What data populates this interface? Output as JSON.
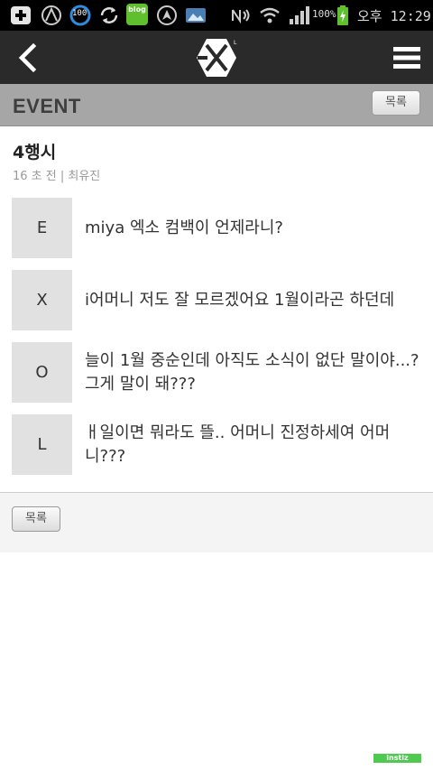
{
  "status_bar": {
    "badge_100": "100",
    "blog_label": "blog",
    "battery_percent": "100%",
    "time_label": "오후 12:29"
  },
  "app_bar": {
    "back_icon": "chevron-left-icon",
    "logo": "exo-logo",
    "menu_icon": "hamburger-menu-icon"
  },
  "section": {
    "title": "EVENT",
    "list_button": "목록"
  },
  "post": {
    "title": "4행시",
    "meta": "16 초 전 | 최유진",
    "rows": [
      {
        "letter": "E",
        "text": "miya 엑소 컴백이 언제라니?"
      },
      {
        "letter": "X",
        "text": "i어머니 저도 잘 모르겠어요 1월이라곤 하던데"
      },
      {
        "letter": "O",
        "text": "늘이 1월 중순인데 아직도 소식이 없단 말이야...? 그게 말이 돼???"
      },
      {
        "letter": "L",
        "text": "ㅐ일이면 뭐라도 뜰.. 어머니 진정하세여 어머니???"
      }
    ]
  },
  "footer": {
    "list_button": "목록"
  },
  "watermark": "instiz",
  "colors": {
    "app_bar": "#2a2a2a",
    "section_bar": "#a6a6a6",
    "letter_box": "#e1e1e1",
    "watermark": "#4fc94f"
  }
}
